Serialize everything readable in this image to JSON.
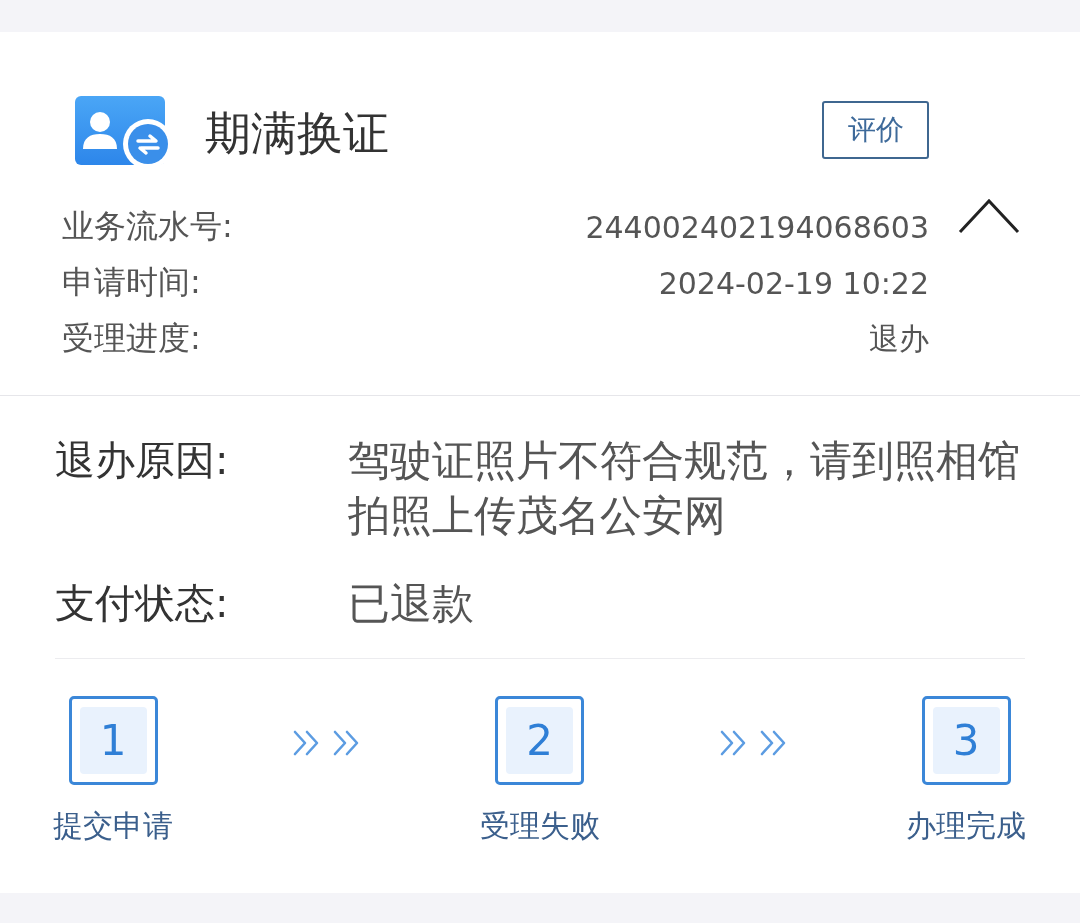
{
  "summary": {
    "title": "期满换证",
    "rate_button": "评价",
    "expanded": true,
    "rows": [
      {
        "label": "业务流水号:",
        "value": "244002402194068603"
      },
      {
        "label": "申请时间:",
        "value": "2024-02-19 10:22"
      },
      {
        "label": "受理进度:",
        "value": "退办"
      }
    ]
  },
  "details": [
    {
      "label": "退办原因:",
      "value": "驾驶证照片不符合规范，请到照相馆拍照上传茂名公安网"
    },
    {
      "label": "支付状态:",
      "value": "已退款"
    }
  ],
  "steps": [
    {
      "number": "1",
      "label": "提交申请"
    },
    {
      "number": "2",
      "label": "受理失败"
    },
    {
      "number": "3",
      "label": "办理完成"
    }
  ]
}
